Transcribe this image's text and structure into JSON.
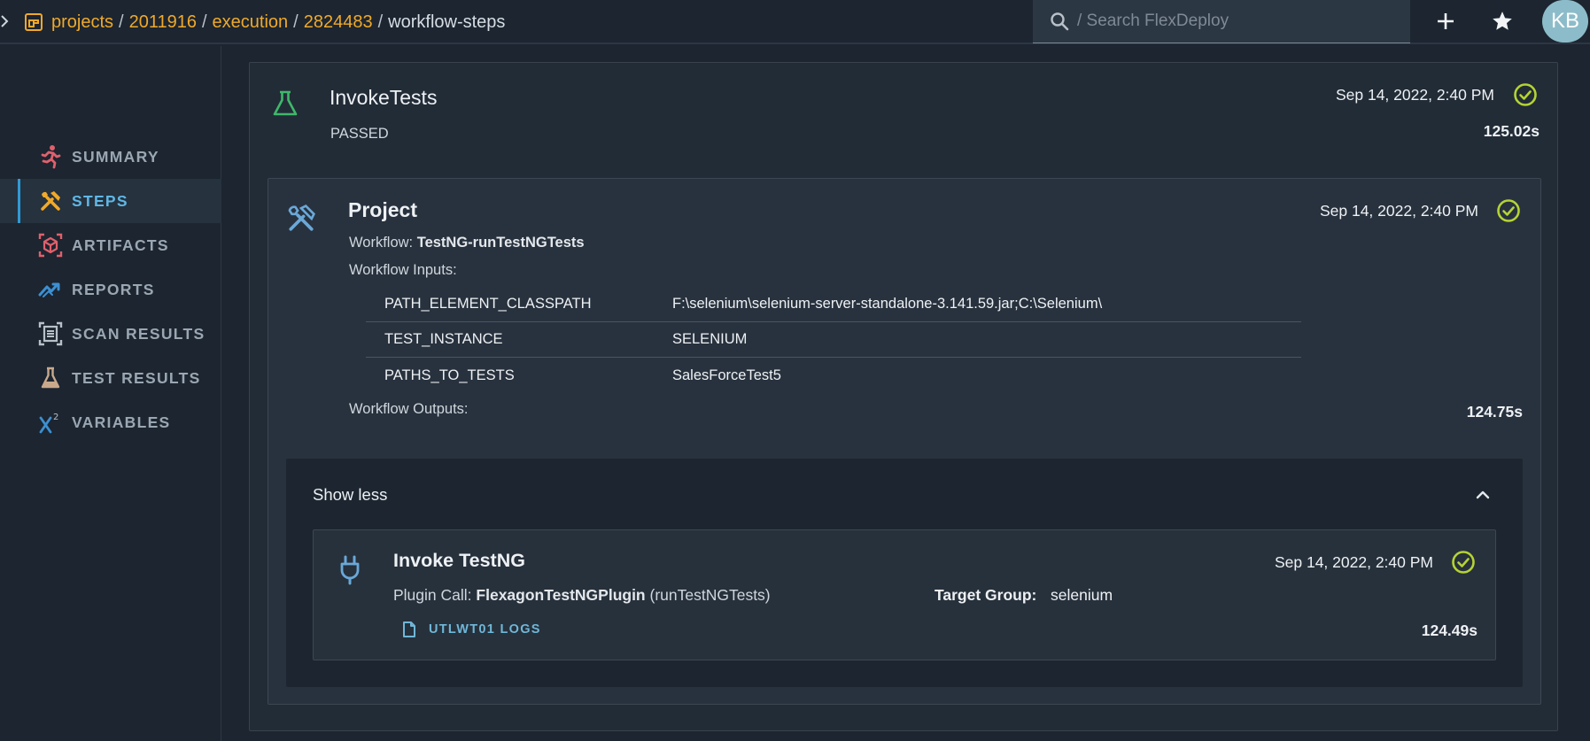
{
  "breadcrumb": {
    "items": [
      {
        "label": "projects"
      },
      {
        "label": "2011916"
      },
      {
        "label": "execution"
      },
      {
        "label": "2824483"
      }
    ],
    "current": "workflow-steps",
    "separator": "/"
  },
  "search": {
    "placeholder": "/ Search FlexDeploy",
    "value": ""
  },
  "user": {
    "initials": "KB"
  },
  "sidebar": {
    "items": [
      {
        "label": "SUMMARY",
        "icon": "runner-icon",
        "active": false
      },
      {
        "label": "STEPS",
        "icon": "tools-icon",
        "active": true
      },
      {
        "label": "ARTIFACTS",
        "icon": "package-icon",
        "active": false
      },
      {
        "label": "REPORTS",
        "icon": "trend-icon",
        "active": false
      },
      {
        "label": "SCAN RESULTS",
        "icon": "scan-icon",
        "active": false
      },
      {
        "label": "TEST RESULTS",
        "icon": "flask-icon",
        "active": false
      },
      {
        "label": "VARIABLES",
        "icon": "variable-icon",
        "active": false
      }
    ]
  },
  "invoke_tests": {
    "title": "InvokeTests",
    "status": "PASSED",
    "date": "Sep 14, 2022, 2:40 PM",
    "duration": "125.02s"
  },
  "project": {
    "title": "Project",
    "date": "Sep 14, 2022, 2:40 PM",
    "workflow_label": "Workflow:",
    "workflow_name": "TestNG-runTestNGTests",
    "inputs_label": "Workflow Inputs:",
    "inputs": [
      {
        "key": "PATH_ELEMENT_CLASSPATH",
        "value": "F:\\selenium\\selenium-server-standalone-3.141.59.jar;C:\\Selenium\\"
      },
      {
        "key": "TEST_INSTANCE",
        "value": "SELENIUM"
      },
      {
        "key": "PATHS_TO_TESTS",
        "value": "SalesForceTest5"
      }
    ],
    "outputs_label": "Workflow Outputs:",
    "duration": "124.75s"
  },
  "show_less": {
    "label": "Show less"
  },
  "step": {
    "title": "Invoke TestNG",
    "date": "Sep 14, 2022, 2:40 PM",
    "plugin_label": "Plugin Call:",
    "plugin_name": "FlexagonTestNGPlugin",
    "plugin_op": "(runTestNGTests)",
    "target_group_label": "Target Group:",
    "target_group": "selenium",
    "logs_label": "UTLWT01 LOGS",
    "duration": "124.49s"
  },
  "colors": {
    "background": "#1c2530",
    "link": "#f0a92a",
    "active_nav": "#5fb7e6",
    "success": "#b5d334"
  }
}
